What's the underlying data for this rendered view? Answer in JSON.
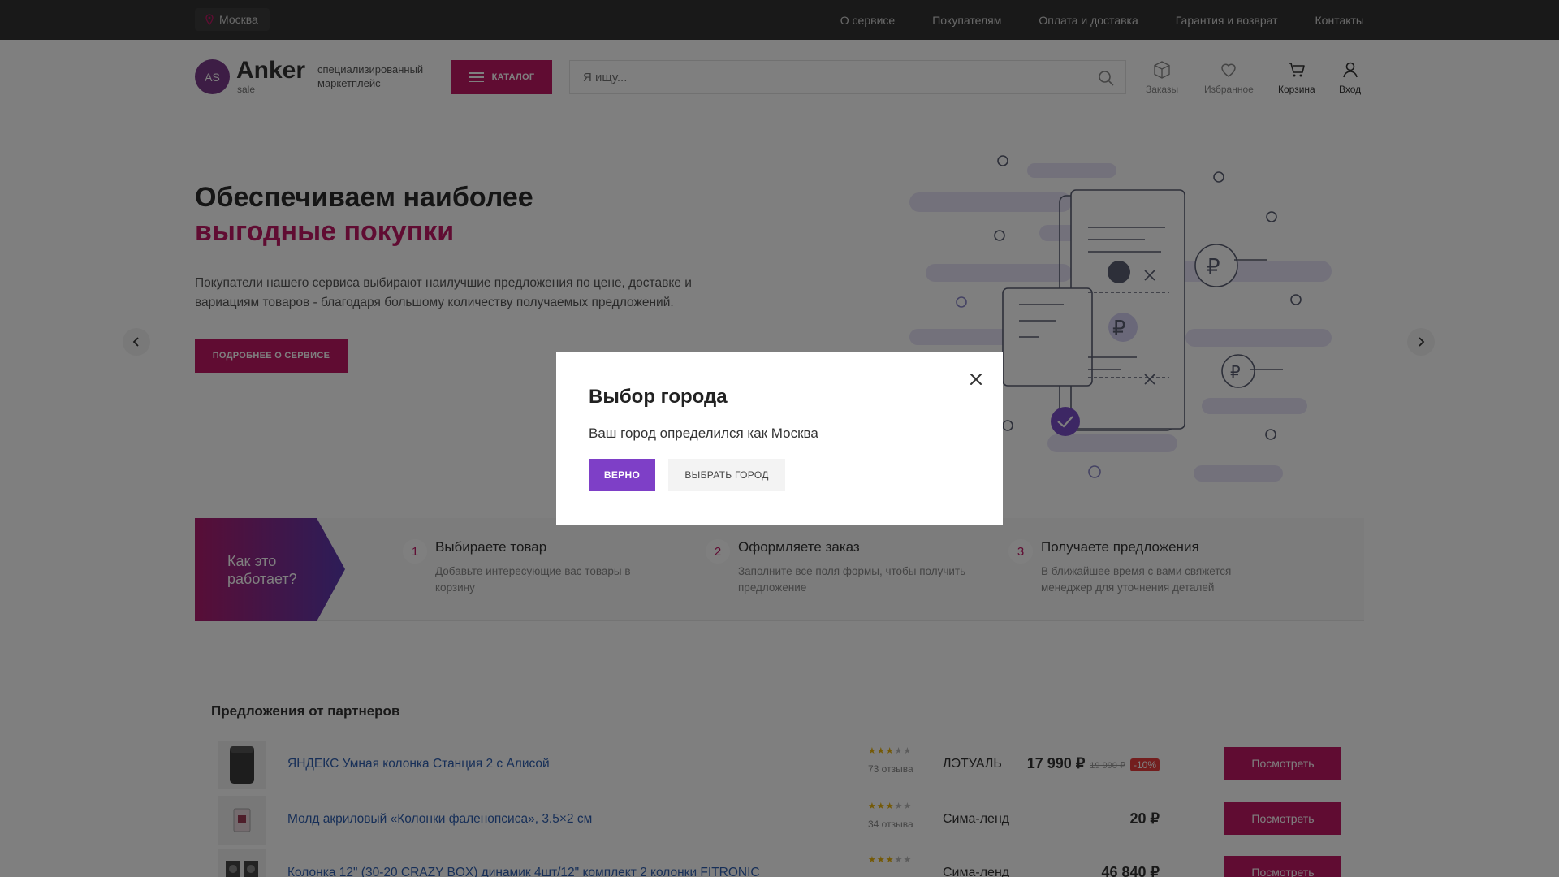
{
  "topbar": {
    "city": "Москва",
    "nav": [
      "О сервисе",
      "Покупателям",
      "Оплата и доставка",
      "Гарантия и возврат",
      "Контакты"
    ]
  },
  "header": {
    "logo_initials": "AS",
    "logo_name": "Anker",
    "logo_sub": "sale",
    "tagline": "специализированный маркетплейс",
    "catalog_label": "КАТАЛОГ",
    "search_placeholder": "Я ищу...",
    "icons": [
      {
        "label": "Заказы",
        "icon": "box-icon"
      },
      {
        "label": "Избранное",
        "icon": "heart-icon"
      },
      {
        "label": "Корзина",
        "icon": "cart-icon"
      },
      {
        "label": "Вход",
        "icon": "user-icon"
      }
    ]
  },
  "hero": {
    "title_line1": "Обеспечиваем наиболее",
    "title_line2": "выгодные покупки",
    "text": "Покупатели нашего сервиса выбирают наилучшие предложения по цене, доставке и вариациям товаров - благодаря большому количеству получаемых предложений.",
    "button": "ПОДРОБНЕЕ О СЕРВИСЕ"
  },
  "how": {
    "label": "Как это работает?",
    "steps": [
      {
        "num": "1",
        "title": "Выбираете товар",
        "desc": "Добавьте интересующие вас товары в корзину"
      },
      {
        "num": "2",
        "title": "Оформляете заказ",
        "desc": "Заполните все поля формы, чтобы получить предложение"
      },
      {
        "num": "3",
        "title": "Получаете предложения",
        "desc": "В ближайшее время с вами свяжется менеджер для уточнения деталей"
      }
    ]
  },
  "partners": {
    "title": "Предложения от партнеров",
    "offers": [
      {
        "name": "ЯНДЕКС Умная колонка Станция 2 с Алисой",
        "rating": 3,
        "reviews": "73 отзыва",
        "shop": "ЛЭТУАЛЬ",
        "price": "17 990 ₽",
        "old_price": "19 990 ₽",
        "discount": "-10%",
        "button": "Посмотреть"
      },
      {
        "name": "Молд акриловый «Колонки фаленопсиса», 3.5×2 см",
        "rating": 3,
        "reviews": "34 отзыва",
        "shop": "Сима-ленд",
        "price": "20 ₽",
        "old_price": "",
        "discount": "",
        "button": "Посмотреть"
      },
      {
        "name": "Колонка 12\" (30-20 CRAZY BOX) динамик 4шт/12\" комплект 2 колонки FITRONIC",
        "rating": 3,
        "reviews": "",
        "shop": "Сима-ленд",
        "price": "46 840 ₽",
        "old_price": "",
        "discount": "",
        "button": "Посмотреть"
      }
    ]
  },
  "modal": {
    "title": "Выбор города",
    "text": "Ваш город определился как Москва",
    "confirm": "ВЕРНО",
    "choose": "ВЫБРАТЬ ГОРОД"
  },
  "colors": {
    "accent": "#c01864",
    "modal_primary": "#7e3fc7",
    "topbar": "#333333"
  }
}
